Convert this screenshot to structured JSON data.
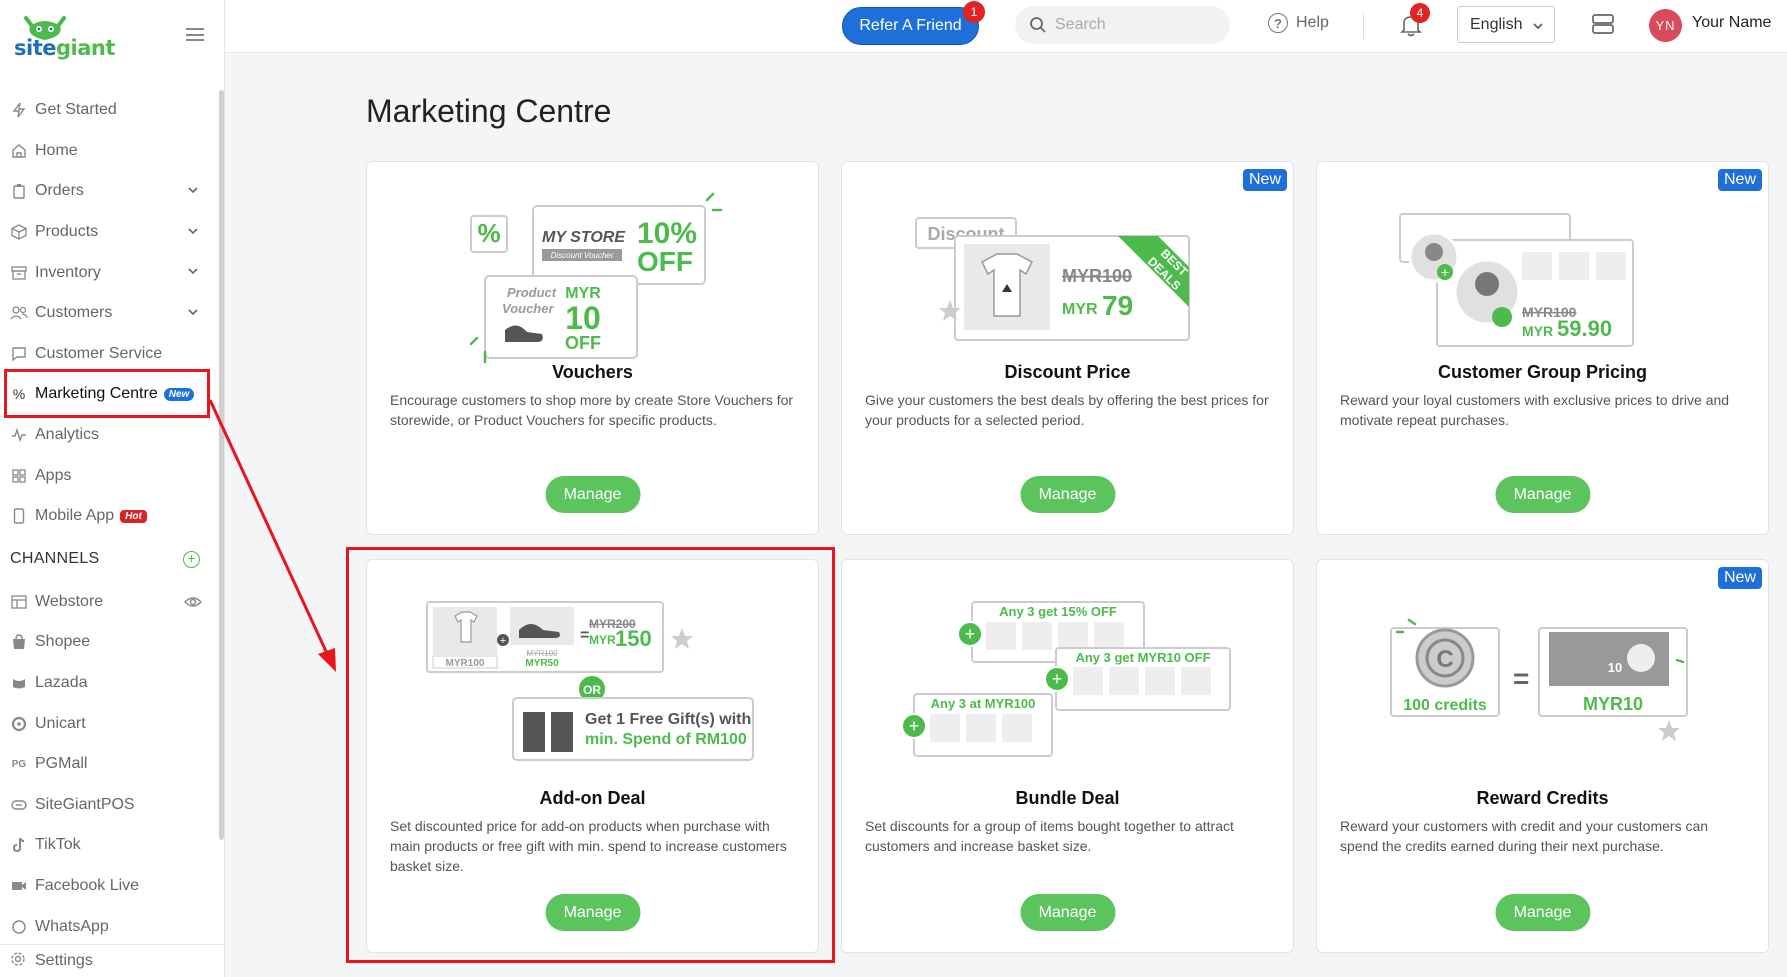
{
  "brand": {
    "logo_text_a": "site",
    "logo_text_b": "giant"
  },
  "topbar": {
    "refer_label": "Refer A Friend",
    "refer_count": "1",
    "search_placeholder": "Search",
    "help_label": "Help",
    "notification_count": "4",
    "language": "English",
    "avatar_initials": "YN",
    "user_name": "Your Name"
  },
  "sidebar": {
    "items": [
      {
        "label": "Get Started",
        "icon": "bolt-icon"
      },
      {
        "label": "Home",
        "icon": "home-icon"
      },
      {
        "label": "Orders",
        "icon": "clipboard-icon"
      },
      {
        "label": "Products",
        "icon": "box-icon"
      },
      {
        "label": "Inventory",
        "icon": "inventory-icon"
      },
      {
        "label": "Customers",
        "icon": "users-icon"
      },
      {
        "label": "Customer Service",
        "icon": "chat-icon"
      },
      {
        "label": "Marketing Centre",
        "icon": "percent-icon",
        "badge": "New"
      },
      {
        "label": "Analytics",
        "icon": "pulse-icon"
      },
      {
        "label": "Apps",
        "icon": "grid-icon"
      },
      {
        "label": "Mobile App",
        "icon": "phone-icon",
        "badge": "Hot"
      }
    ],
    "channels_heading": "CHANNELS",
    "channels": [
      {
        "label": "Webstore",
        "icon": "webstore-icon"
      },
      {
        "label": "Shopee",
        "icon": "shopee-icon"
      },
      {
        "label": "Lazada",
        "icon": "lazada-icon"
      },
      {
        "label": "Unicart",
        "icon": "unicart-icon"
      },
      {
        "label": "PGMall",
        "icon": "pgmall-icon"
      },
      {
        "label": "SiteGiantPOS",
        "icon": "pos-icon"
      },
      {
        "label": "TikTok",
        "icon": "tiktok-icon"
      },
      {
        "label": "Facebook Live",
        "icon": "video-icon"
      },
      {
        "label": "WhatsApp",
        "icon": "whatsapp-icon"
      }
    ],
    "settings_label": "Settings"
  },
  "main": {
    "title": "Marketing Centre",
    "manage_label": "Manage",
    "new_label": "New",
    "cards": [
      {
        "title": "Vouchers",
        "desc": "Encourage customers to shop more by create Store Vouchers for storewide, or Product Vouchers for specific products.",
        "illus": {
          "store": "MY STORE",
          "store_sub": "Discount Voucher",
          "pct": "10%",
          "off": "OFF",
          "pv_line1": "Product",
          "pv_line2": "Voucher",
          "myr": "MYR",
          "amt": "10",
          "off2": "OFF"
        }
      },
      {
        "title": "Discount Price",
        "desc": "Give your customers the best deals by offering the best prices for your products for a selected period.",
        "illus": {
          "tag": "Discount",
          "old": "MYR100",
          "new_cur": "MYR",
          "new_amt": "79",
          "ribbon1": "BEST",
          "ribbon2": "DEALS"
        }
      },
      {
        "title": "Customer Group Pricing",
        "desc": "Reward your loyal customers with exclusive prices to drive and motivate repeat purchases.",
        "illus": {
          "old": "MYR100",
          "new_cur": "MYR",
          "new_amt": "59.90"
        }
      },
      {
        "title": "Add-on Deal",
        "desc": "Set discounted price for add-on products when purchase with main products or free gift with min. spend to increase customers basket size.",
        "illus": {
          "p1": "MYR100",
          "p2_old": "MYR100",
          "p2_new": "MYR50",
          "total_old": "MYR200",
          "total_cur": "MYR",
          "total_new": "150",
          "or": "OR",
          "gift1": "Get 1 Free Gift(s) with",
          "gift2": "min. Spend of RM100"
        }
      },
      {
        "title": "Bundle Deal",
        "desc": "Set discounts for a group of items bought together to attract customers and increase basket size.",
        "illus": {
          "b1": "Any 3 get 15% OFF",
          "b2": "Any 3 get MYR10 OFF",
          "b3": "Any 3 at MYR100"
        }
      },
      {
        "title": "Reward Credits",
        "desc": "Reward your customers with credit and your customers can spend the credits earned during their next purchase.",
        "illus": {
          "credits": "100 credits",
          "eq": "=",
          "myr": "MYR10",
          "note_num": "10"
        }
      }
    ]
  },
  "colors": {
    "accent_green": "#5cc45c",
    "brand_blue": "#1e6fd9",
    "highlight_red": "#e8151b"
  }
}
